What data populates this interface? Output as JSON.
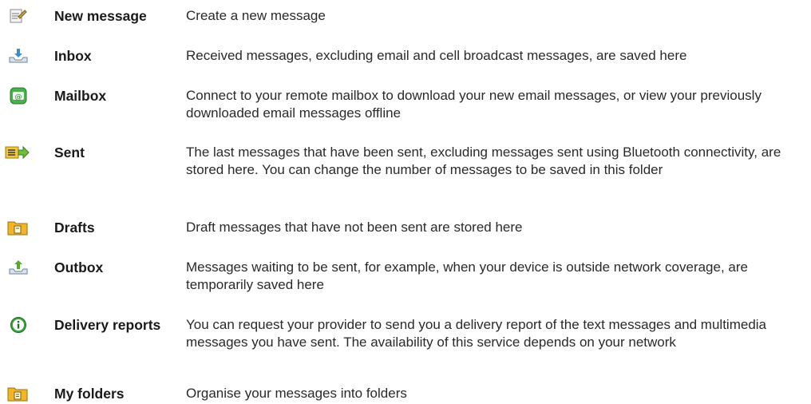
{
  "items": [
    {
      "icon": "new-message-icon",
      "term": "New message",
      "description": "Create a new message"
    },
    {
      "icon": "inbox-icon",
      "term": "Inbox",
      "description": "Received messages, excluding email and cell broadcast messages, are saved here"
    },
    {
      "icon": "mailbox-icon",
      "term": "Mailbox",
      "description": "Connect to your remote mailbox to download your new email messages, or view your previously downloaded email messages offline"
    },
    {
      "icon": "sent-icon",
      "term": "Sent",
      "description": "The last messages that have been sent, excluding messages sent using Bluetooth connectivity, are stored here. You can change the number of messages to be saved in this folder"
    },
    {
      "icon": "drafts-icon",
      "term": "Drafts",
      "description": "Draft messages that have not been sent are stored here"
    },
    {
      "icon": "outbox-icon",
      "term": "Outbox",
      "description": "Messages waiting to be sent, for example, when your device is outside network coverage, are temporarily saved here"
    },
    {
      "icon": "info-icon",
      "term": "Delivery reports",
      "description": "You can request your provider to send you a delivery report of the text messages and multimedia messages you have sent. The availability of this service depends on your network"
    },
    {
      "icon": "my-folders-icon",
      "term": "My folders",
      "description": "Organise your messages into folders"
    }
  ]
}
